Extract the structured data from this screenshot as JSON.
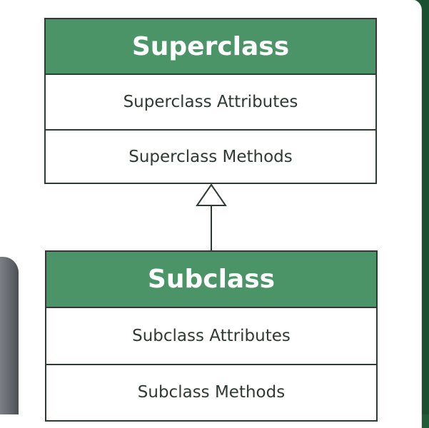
{
  "diagram": {
    "superclass": {
      "name": "Superclass",
      "attributes": "Superclass Attributes",
      "methods": "Superclass Methods"
    },
    "subclass": {
      "name": "Subclass",
      "attributes": "Subclass Attributes",
      "methods": "Subclass Methods"
    },
    "relationship": "inheritance",
    "colors": {
      "header": "#4a9468",
      "border": "#2f3a33",
      "background": "#1f5d38"
    }
  }
}
